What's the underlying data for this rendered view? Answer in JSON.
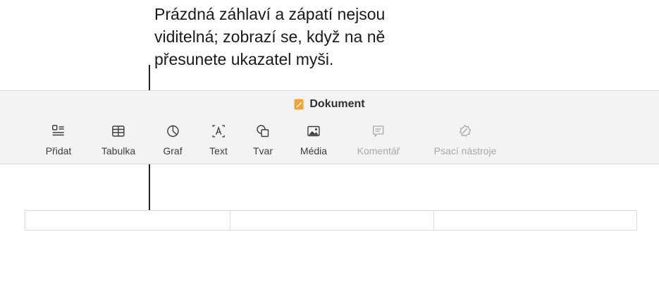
{
  "callout": {
    "lines": [
      "Prázdná záhlaví a zápatí nejsou",
      "viditelná; zobrazí se, když na ně",
      "přesunete ukazatel myši."
    ]
  },
  "window": {
    "title": "Dokument",
    "document_icon": "pages-document-icon"
  },
  "toolbar": {
    "items": [
      {
        "label": "Přidat",
        "icon": "add-icon",
        "enabled": true
      },
      {
        "label": "Tabulka",
        "icon": "table-icon",
        "enabled": true
      },
      {
        "label": "Graf",
        "icon": "chart-icon",
        "enabled": true
      },
      {
        "label": "Text",
        "icon": "text-box-icon",
        "enabled": true
      },
      {
        "label": "Tvar",
        "icon": "shape-icon",
        "enabled": true
      },
      {
        "label": "Média",
        "icon": "media-icon",
        "enabled": true
      },
      {
        "label": "Komentář",
        "icon": "comment-icon",
        "enabled": false
      },
      {
        "label": "Psací nástroje",
        "icon": "writing-tools-icon",
        "enabled": false
      }
    ]
  },
  "document": {
    "header_cells": 3
  },
  "colors": {
    "toolbar_bg": "#f3f3f3",
    "icon": "#3c3c3c",
    "disabled": "#a8a8a8",
    "doc_icon": "#f2a33a"
  }
}
